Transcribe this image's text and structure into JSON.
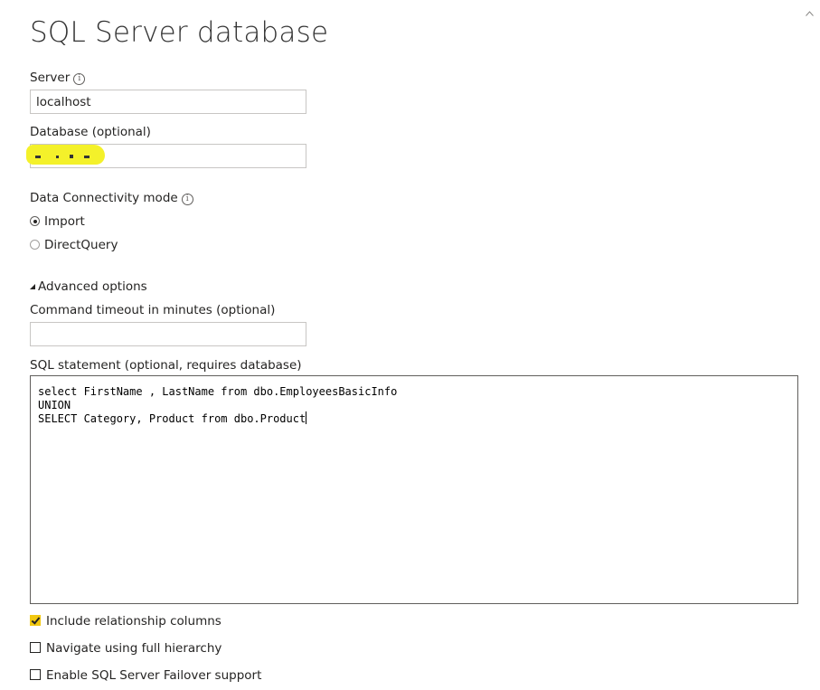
{
  "dialog": {
    "title": "SQL Server database"
  },
  "server": {
    "label": "Server",
    "value": "localhost"
  },
  "database": {
    "label": "Database (optional)",
    "value": ""
  },
  "connectivity": {
    "label": "Data Connectivity mode",
    "options": [
      "Import",
      "DirectQuery"
    ],
    "selected": "Import"
  },
  "advanced": {
    "toggle_label": "Advanced options",
    "timeout_label": "Command timeout in minutes (optional)",
    "timeout_value": "",
    "sql_label": "SQL statement (optional, requires database)",
    "sql_lines": [
      "select FirstName , LastName from dbo.EmployeesBasicInfo",
      "UNION",
      "SELECT Category, Product from dbo.Product"
    ]
  },
  "checkboxes": [
    {
      "label": "Include relationship columns",
      "checked": true
    },
    {
      "label": "Navigate using full hierarchy",
      "checked": false
    },
    {
      "label": "Enable SQL Server Failover support",
      "checked": false
    }
  ],
  "colors": {
    "accent": "#f2c811",
    "redaction": "#f4f12a"
  },
  "icons": {
    "info": "info-icon",
    "caret": "caret-down-icon",
    "scroll": "scroll-up-icon"
  }
}
